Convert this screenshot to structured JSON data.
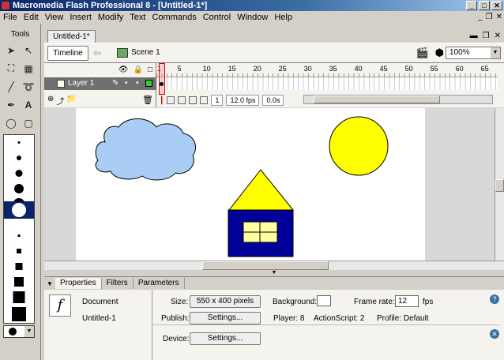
{
  "window": {
    "title": "Macromedia Flash Professional 8 - [Untitled-1*]",
    "controls": [
      "_",
      "□",
      "✕"
    ]
  },
  "menu": [
    "File",
    "Edit",
    "View",
    "Insert",
    "Modify",
    "Text",
    "Commands",
    "Control",
    "Window",
    "Help"
  ],
  "tools": {
    "title": "Tools"
  },
  "document": {
    "tab_label": "Untitled-1*"
  },
  "edit_bar": {
    "timeline_label": "Timeline",
    "scene_label": "Scene 1",
    "zoom_value": "100%"
  },
  "timeline": {
    "layer_name": "Layer 1",
    "frame_numbers": [
      "1",
      "5",
      "10",
      "15",
      "20",
      "25",
      "30",
      "35",
      "40",
      "45",
      "50",
      "55",
      "60",
      "65"
    ],
    "current_frame": "1",
    "fps": "12.0 fps",
    "time": "0.0s"
  },
  "stage": {
    "colors": {
      "cloud": "#a9cdf5",
      "sun": "#ffff00",
      "roof": "#ffff00",
      "house": "#000099",
      "window": "#ffffa0"
    }
  },
  "properties": {
    "tabs": [
      "Properties",
      "Filters",
      "Parameters"
    ],
    "doc_type": "Document",
    "doc_name": "Untitled-1",
    "size_label": "Size:",
    "size_value": "550 x 400 pixels",
    "background_label": "Background:",
    "framerate_label": "Frame rate:",
    "framerate_value": "12",
    "fps_unit": "fps",
    "publish_label": "Publish:",
    "settings_label": "Settings...",
    "player_label": "Player: 8",
    "actionscript_label": "ActionScript: 2",
    "profile_label": "Profile: Default",
    "device_label": "Device:"
  }
}
